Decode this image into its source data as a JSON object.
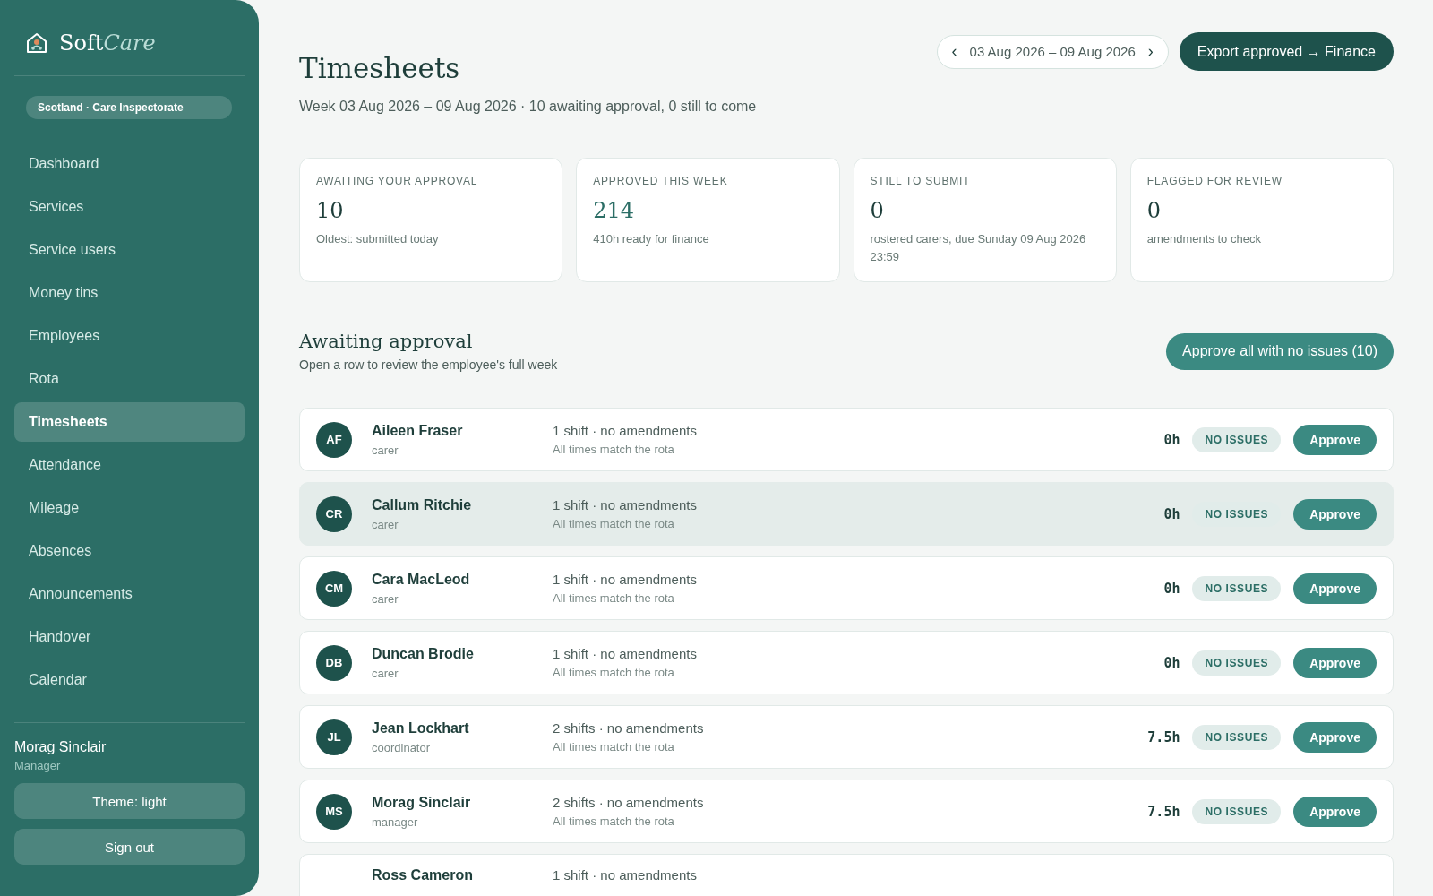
{
  "brand": {
    "name": "Soft",
    "name_italic": "Care"
  },
  "region": "Scotland · Care Inspectorate",
  "nav": [
    {
      "label": "Dashboard",
      "selected": false
    },
    {
      "label": "Services",
      "selected": false
    },
    {
      "label": "Service users",
      "selected": false
    },
    {
      "label": "Money tins",
      "selected": false
    },
    {
      "label": "Employees",
      "selected": false
    },
    {
      "label": "Rota",
      "selected": false
    },
    {
      "label": "Timesheets",
      "selected": true
    },
    {
      "label": "Attendance",
      "selected": false
    },
    {
      "label": "Mileage",
      "selected": false
    },
    {
      "label": "Absences",
      "selected": false
    },
    {
      "label": "Announcements",
      "selected": false
    },
    {
      "label": "Handover",
      "selected": false
    },
    {
      "label": "Calendar",
      "selected": false
    }
  ],
  "user": {
    "name": "Morag Sinclair",
    "role": "Manager"
  },
  "sidebar_buttons": [
    "Theme: light",
    "Sign out"
  ],
  "page": {
    "title": "Timesheets",
    "subtitle": "Week 03 Aug 2026 – 09 Aug 2026 · 10 awaiting approval, 0 still to come"
  },
  "week_picker": {
    "prev": "‹",
    "range": "03 Aug 2026 – 09 Aug 2026",
    "next": "›"
  },
  "export_button": "Export approved → Finance",
  "stats": [
    {
      "label": "AWAITING YOUR APPROVAL",
      "value": "10",
      "note": "Oldest: submitted today",
      "accent": false
    },
    {
      "label": "APPROVED THIS WEEK",
      "value": "214",
      "note": "410h ready for finance",
      "accent": true
    },
    {
      "label": "STILL TO SUBMIT",
      "value": "0",
      "note": "rostered carers, due Sunday 09 Aug 2026 23:59",
      "accent": false
    },
    {
      "label": "FLAGGED FOR REVIEW",
      "value": "0",
      "note": "amendments to check",
      "accent": false
    }
  ],
  "section": {
    "title": "Awaiting approval",
    "subtitle": "Open a row to review the employee's full week",
    "action": "Approve all with no issues (10)"
  },
  "rows": [
    {
      "initials": "AF",
      "name": "Aileen Fraser",
      "role": "carer",
      "summary": "1 shift · no amendments",
      "detail": "All times match the rota",
      "hours": "0h",
      "status": "NO ISSUES",
      "action": "Approve",
      "selected": false
    },
    {
      "initials": "CR",
      "name": "Callum Ritchie",
      "role": "carer",
      "summary": "1 shift · no amendments",
      "detail": "All times match the rota",
      "hours": "0h",
      "status": "NO ISSUES",
      "action": "Approve",
      "selected": true
    },
    {
      "initials": "CM",
      "name": "Cara MacLeod",
      "role": "carer",
      "summary": "1 shift · no amendments",
      "detail": "All times match the rota",
      "hours": "0h",
      "status": "NO ISSUES",
      "action": "Approve",
      "selected": false
    },
    {
      "initials": "DB",
      "name": "Duncan Brodie",
      "role": "carer",
      "summary": "1 shift · no amendments",
      "detail": "All times match the rota",
      "hours": "0h",
      "status": "NO ISSUES",
      "action": "Approve",
      "selected": false
    },
    {
      "initials": "JL",
      "name": "Jean Lockhart",
      "role": "coordinator",
      "summary": "2 shifts · no amendments",
      "detail": "All times match the rota",
      "hours": "7.5h",
      "status": "NO ISSUES",
      "action": "Approve",
      "selected": false
    },
    {
      "initials": "MS",
      "name": "Morag Sinclair",
      "role": "manager",
      "summary": "2 shifts · no amendments",
      "detail": "All times match the rota",
      "hours": "7.5h",
      "status": "NO ISSUES",
      "action": "Approve",
      "selected": false
    },
    {
      "name": "Ross Cameron",
      "summary": "1 shift · no amendments",
      "selected": false
    }
  ]
}
